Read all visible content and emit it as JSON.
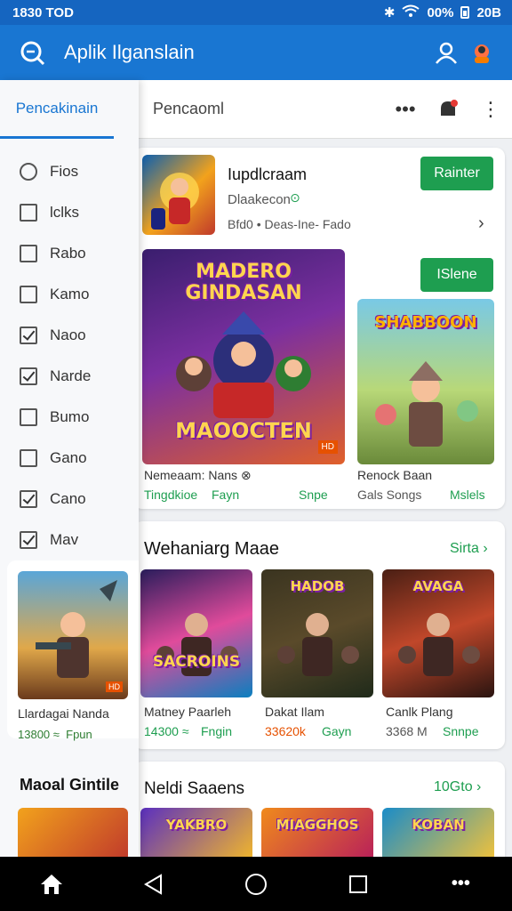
{
  "status": {
    "time": "1830 TOD",
    "battery": "00%",
    "network": "20B"
  },
  "appbar": {
    "title": "Aplik Ilganslain"
  },
  "drawer": {
    "tab_label": "Pencakinain",
    "items": [
      {
        "label": "Fios",
        "state": "round"
      },
      {
        "label": "lclks",
        "state": "empty"
      },
      {
        "label": "Rabo",
        "state": "empty"
      },
      {
        "label": "Kamo",
        "state": "empty"
      },
      {
        "label": "Naoo",
        "state": "checked"
      },
      {
        "label": "Narde",
        "state": "checked"
      },
      {
        "label": "Bumo",
        "state": "empty"
      },
      {
        "label": "Gano",
        "state": "empty"
      },
      {
        "label": "Cano",
        "state": "checked"
      },
      {
        "label": "Mav",
        "state": "checked"
      }
    ],
    "card": {
      "name": "Llardagai Nanda",
      "meta_left": "13800 ≈",
      "meta_right": "Fpun",
      "badge": "HD"
    },
    "bottom_title": "Maoal Gintile"
  },
  "tabs": {
    "secondary_label": "Pencaoml"
  },
  "featured": {
    "app_title": "Iupdlcraam",
    "app_subtitle": "Dlaakecon",
    "app_meta": "Bfd0 •  Deas-Ine- Fado",
    "install_label": "Rainter",
    "second_button": "ISlene",
    "big_game": {
      "art_title": "MADERO GINDASAN",
      "art_bottom": "MAOOCTEN",
      "name": "Nemeaam: Nans ⊗",
      "meta_left": "Tingdkioe",
      "meta_mid": "Fayn",
      "meta_right": "Snpe",
      "badge": "HD"
    },
    "side_game": {
      "art_title": "SHABBOON",
      "name": "Renock Baan",
      "meta_left": "Gals Songs",
      "meta_right": "Mslels"
    }
  },
  "section2": {
    "title": "Wehaniarg Maae",
    "link": "Sirta",
    "games": [
      {
        "name": "Matney Paarleh",
        "meta_left": "14300 ≈",
        "meta_right": "Fngin",
        "art": "SACROINS",
        "colors": [
          "#2a1d5c",
          "#e04b9b",
          "#0b7fbf"
        ]
      },
      {
        "name": "Dakat Ilam",
        "meta_left": "33620k",
        "meta_right": "Gayn",
        "art": "HADOB",
        "colors": [
          "#3a3420",
          "#5a4a2a",
          "#1f2a1a"
        ]
      },
      {
        "name": "Canlk Plang",
        "meta_left": "3368 M",
        "meta_right": "Snnpe",
        "art": "AVAGA",
        "colors": [
          "#4a1f14",
          "#c0472a",
          "#2a1410"
        ]
      }
    ]
  },
  "section3": {
    "title": "Neldi Saaens",
    "link": "10Gto",
    "games": [
      {
        "art": "YAKBRO",
        "colors": [
          "#5a2fc0",
          "#f2b72a"
        ]
      },
      {
        "art": "MIAGGHOS",
        "colors": [
          "#f08a1c",
          "#b81f5a"
        ]
      },
      {
        "art": "KOBAN",
        "colors": [
          "#1a8cc8",
          "#f2c23a"
        ]
      }
    ]
  },
  "colors": {
    "primary": "#1976d2",
    "status": "#1565c0",
    "accent_green": "#1e9e50"
  }
}
